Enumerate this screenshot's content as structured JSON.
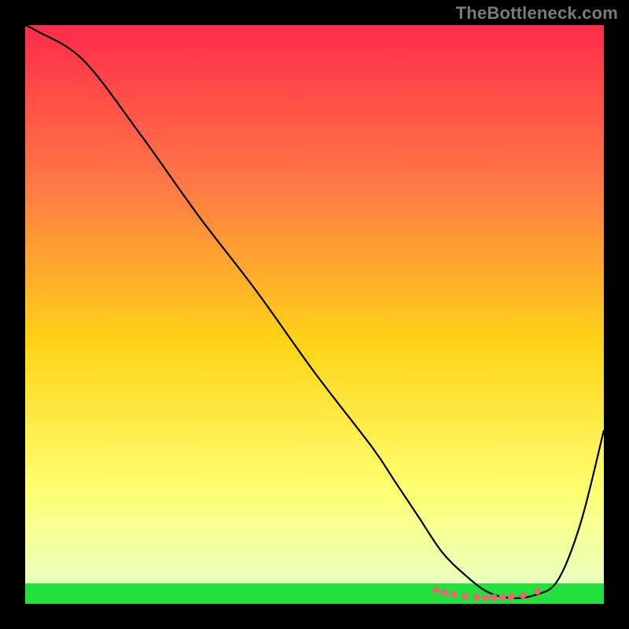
{
  "attribution": "TheBottleneck.com",
  "colors": {
    "frame": "#000000",
    "attribution_text": "#7a7a7a",
    "curve": "#000000",
    "dots": "#e26b6b",
    "green_band": "#24e03c",
    "gradient_top": "#ff2b4b",
    "gradient_mid_upper": "#ff7a45",
    "gradient_mid": "#ffd416",
    "gradient_mid_lower": "#ffff70",
    "gradient_bottom": "#eaffc0"
  },
  "chart_data": {
    "type": "line",
    "title": "",
    "xlabel": "",
    "ylabel": "",
    "xlim": [
      0,
      100
    ],
    "ylim": [
      0,
      100
    ],
    "series": [
      {
        "name": "bottleneck-curve",
        "x": [
          0,
          2,
          10,
          20,
          30,
          40,
          50,
          60,
          64,
          68,
          72,
          76,
          80,
          84,
          88,
          92,
          96,
          100
        ],
        "values": [
          100,
          99,
          94,
          81,
          67,
          54,
          40,
          27,
          21,
          15,
          9,
          5,
          2,
          1,
          1.5,
          4,
          14,
          30
        ]
      }
    ],
    "highlight_points": {
      "name": "best-match",
      "x": [
        71,
        72.5,
        74,
        76,
        78,
        79.5,
        81,
        82.5,
        84,
        86,
        88.5
      ],
      "values": [
        2.4,
        2.0,
        1.7,
        1.4,
        1.2,
        1.1,
        1.1,
        1.2,
        1.3,
        1.5,
        2.2
      ]
    },
    "green_band_y": [
      0,
      3
    ]
  }
}
